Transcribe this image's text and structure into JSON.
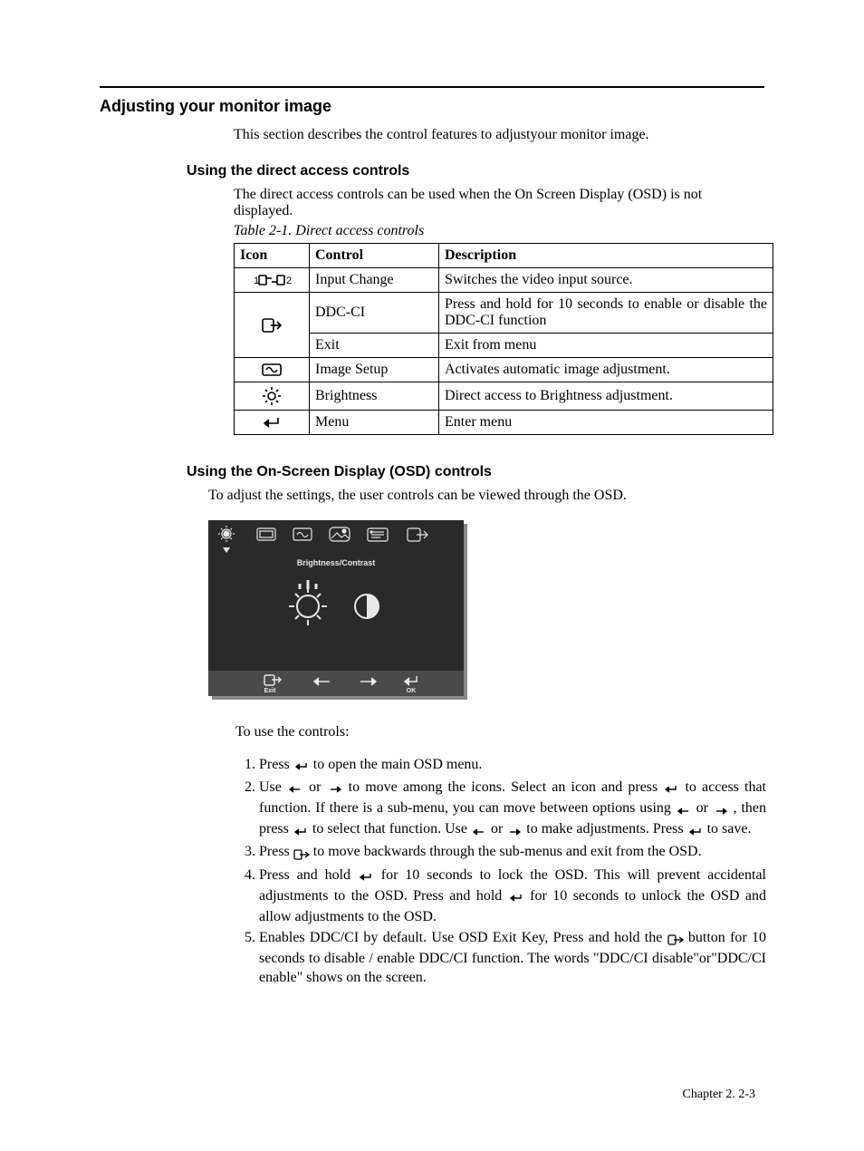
{
  "heading": "Adjusting your monitor image",
  "intro": "This section describes the control features to adjustyour monitor image.",
  "sub1_heading": "Using the direct access controls",
  "sub1_intro": "The direct access controls can be used when the On Screen Display (OSD) is not displayed.",
  "table_caption": "Table 2-1. Direct access controls",
  "table_headers": {
    "icon": "Icon",
    "control": "Control",
    "description": "Description"
  },
  "table": {
    "row0": {
      "control": "Input Change",
      "description": "Switches the video input source."
    },
    "row1a": {
      "control": "DDC-CI",
      "description": "Press and hold for 10 seconds to enable or disable the DDC-CI function"
    },
    "row1b": {
      "control": "Exit",
      "description": "Exit from menu"
    },
    "row2": {
      "control": "Image Setup",
      "description": "Activates automatic image adjustment."
    },
    "row3": {
      "control": "Brightness",
      "description": "Direct access to Brightness adjustment."
    },
    "row4": {
      "control": "Menu",
      "description": "Enter menu"
    }
  },
  "sub2_heading": "Using the On-Screen Display (OSD) controls",
  "sub2_intro": "To adjust the settings, the user controls can be viewed through the OSD.",
  "osd": {
    "title": "Brightness/Contrast",
    "nav": {
      "exit": "Exit",
      "ok": "OK"
    }
  },
  "instructions_lead": "To use the controls:",
  "steps": {
    "s1_a": "Press ",
    "s1_b": " to open the main OSD menu.",
    "s2_a": "Use ",
    "s2_b": " or ",
    "s2_c": " to move among the icons. Select an icon and press ",
    "s2_d": " to access that function. If there is a sub-menu, you can move between options using ",
    "s2_e": " or ",
    "s2_f": " , then press ",
    "s2_g": " to select that function. Use ",
    "s2_h": " or ",
    "s2_i": " to make adjustments. Press ",
    "s2_j": " to save.",
    "s3_a": "Press ",
    "s3_b": " to move backwards through the sub-menus and exit from the OSD.",
    "s4_a": "Press and hold  ",
    "s4_b": "  for 10 seconds to lock the OSD. This will prevent accidental adjustments to the OSD. Press and hold  ",
    "s4_c": "  for 10  seconds to unlock the OSD and allow adjustments to the OSD.",
    "s5_a": "Enables DDC/CI by default. Use OSD Exit Key, Press and hold the ",
    "s5_b": " button for 10 seconds to disable / enable DDC/CI function. The words \"DDC/CI disable\"or\"DDC/CI enable\" shows on the screen."
  },
  "footer": "Chapter 2.   2-3"
}
